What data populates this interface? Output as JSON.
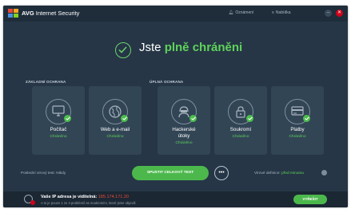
{
  "app": {
    "brand": "AVG",
    "product": "Internet Security"
  },
  "titlebar": {
    "notifications_label": "Oznámení",
    "menu_label": "Nabídka"
  },
  "hero": {
    "title_plain": "Jste ",
    "title_accent": "plně chráněni"
  },
  "sections": {
    "basic": "ZÁKLADNÍ OCHRANA",
    "full": "ÚPLNÁ OCHRANA"
  },
  "tiles": [
    {
      "label": "Počítač",
      "status": "Chráněno",
      "icon": "computer-icon"
    },
    {
      "label": "Web a e-mail",
      "status": "Chráněno",
      "icon": "globe-icon"
    },
    {
      "label": "Hackerské útoky",
      "status": "Chráněno",
      "icon": "hacker-icon"
    },
    {
      "label": "Soukromí",
      "status": "Chráněno",
      "icon": "lock-icon"
    },
    {
      "label": "Platby",
      "status": "Chráněno",
      "icon": "credit-card-icon"
    }
  ],
  "bottom": {
    "last_scan": "Poslední virový test: Nikdy",
    "scan_button": "SPUSTIT CELKOVÝ TEST",
    "more_button": "•••",
    "definitions_label": "Virové definice:",
    "definitions_value": "před minutou"
  },
  "ip_bar": {
    "line1_prefix": "Vaše IP adresa je viditelná:",
    "ip": "185.174.171.20",
    "line2": "A to je pouze 1 ze 4 problémů se soukromím, které jsme objevili",
    "solve_button": "VYŘEŠIT"
  },
  "colors": {
    "window_bg": "#263646",
    "tile_bg": "#324555",
    "accent_green": "#5fd35a",
    "warning_red": "#d0021b"
  }
}
